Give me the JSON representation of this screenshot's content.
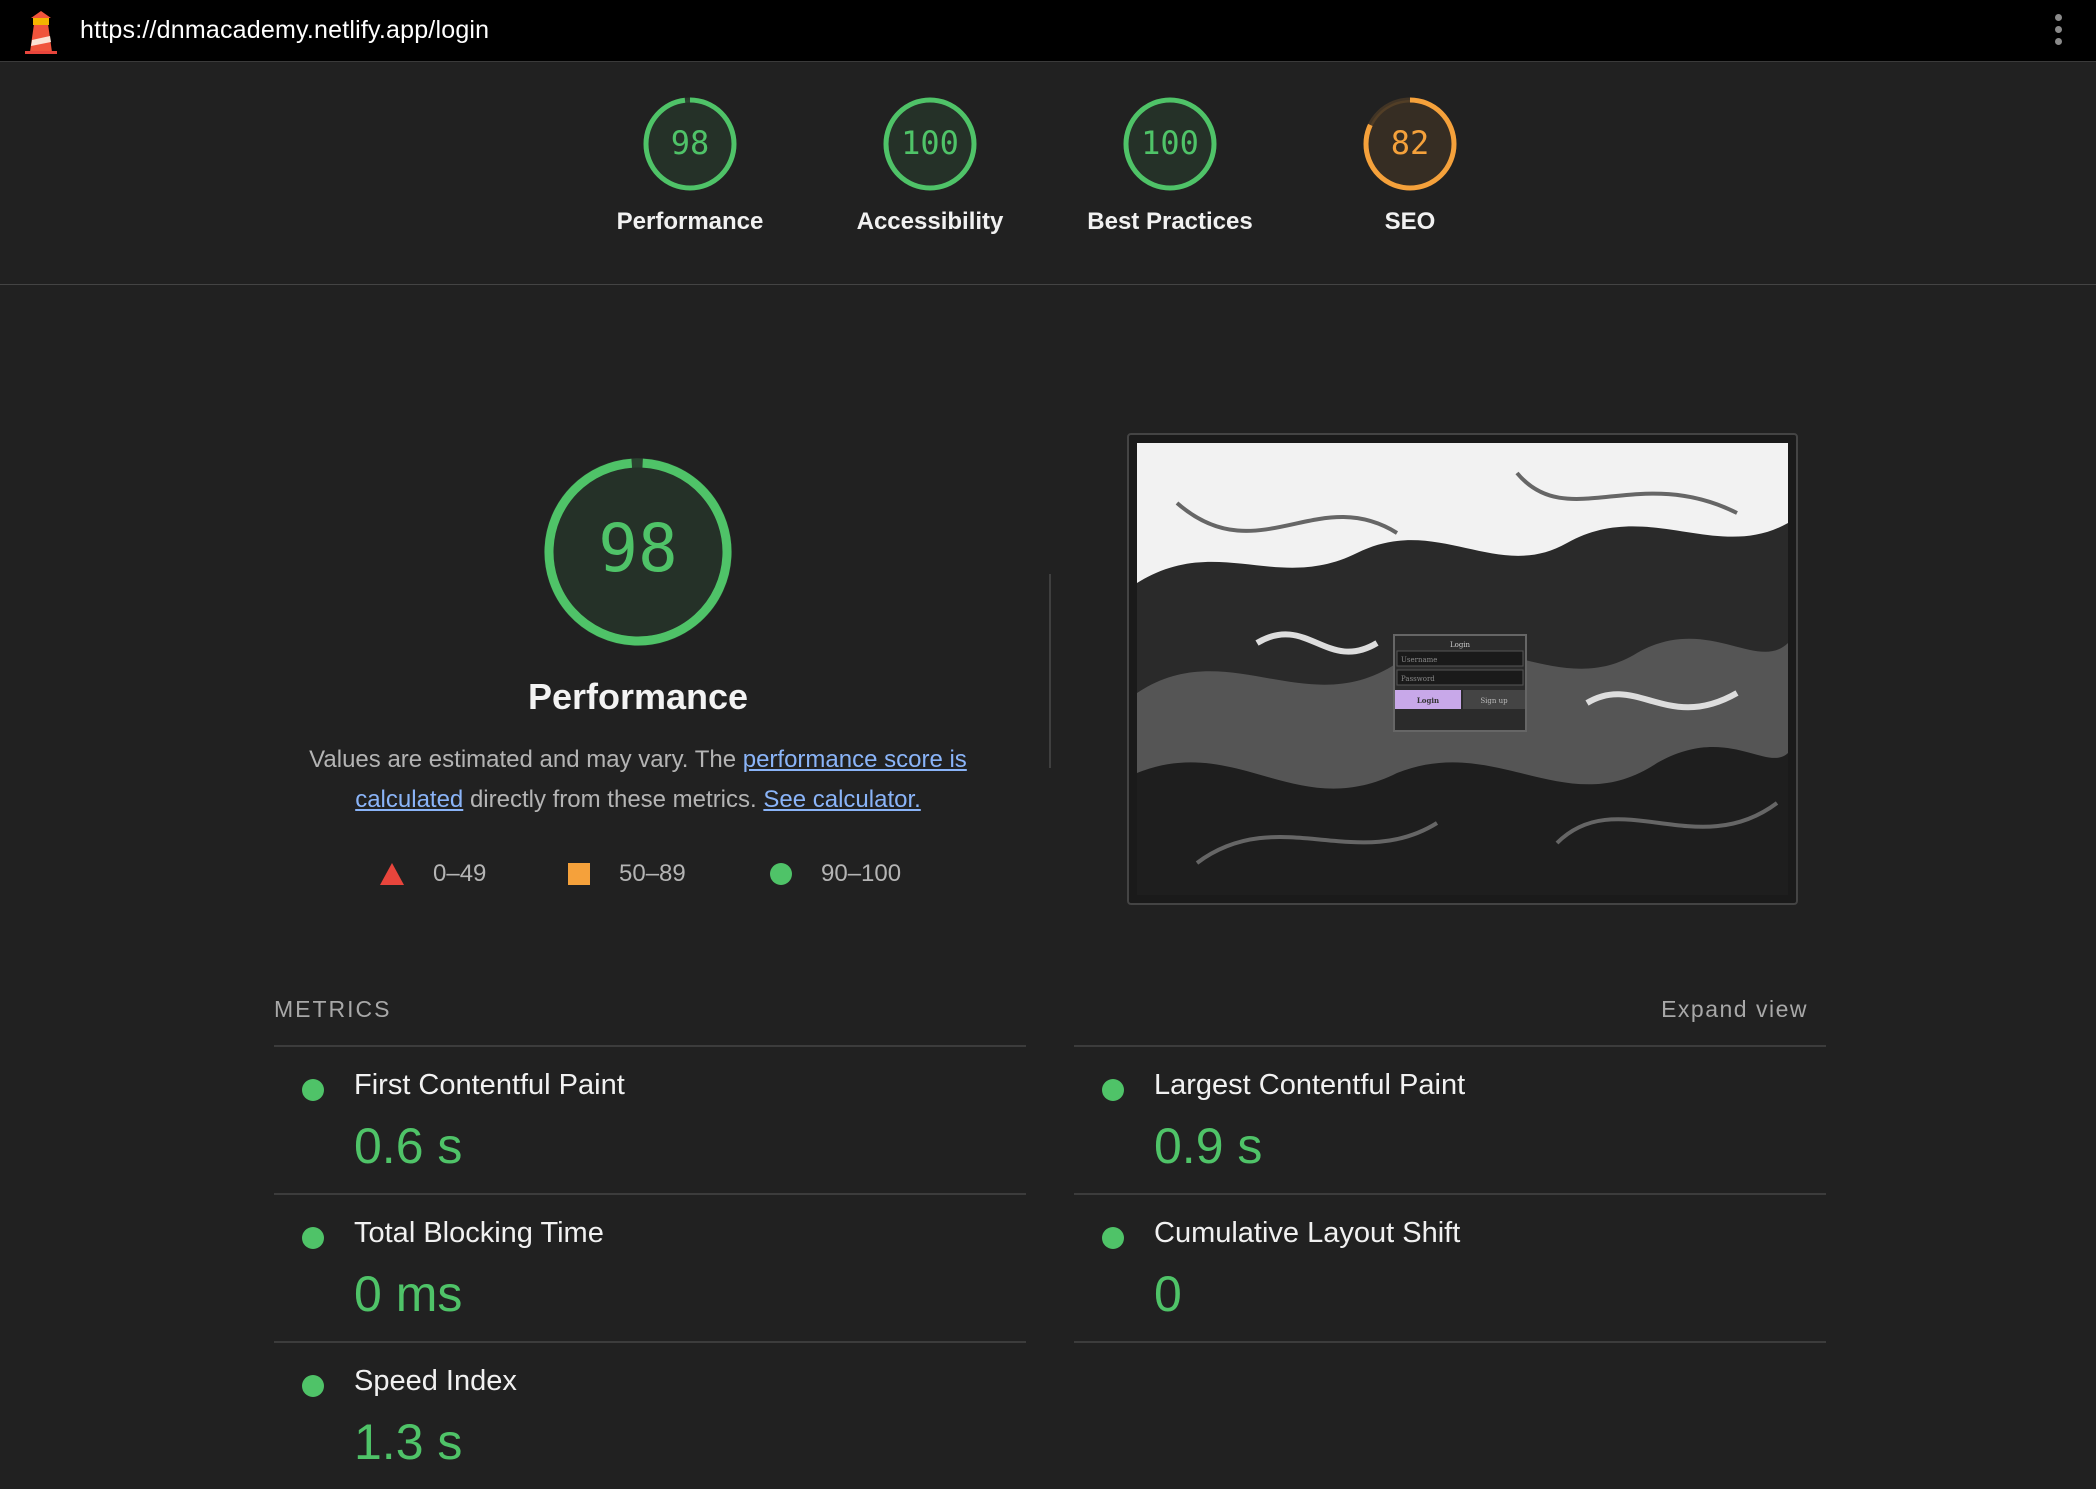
{
  "browser": {
    "url": "https://dnmacademy.netlify.app/login",
    "logo_icon": "lighthouse-icon",
    "menu_icon": "kebab-menu-icon"
  },
  "categories": [
    {
      "label": "Performance",
      "score": "98",
      "color": "#4fc368",
      "fraction": 0.98
    },
    {
      "label": "Accessibility",
      "score": "100",
      "color": "#4fc368",
      "fraction": 1.0
    },
    {
      "label": "Best Practices",
      "score": "100",
      "color": "#4fc368",
      "fraction": 1.0
    },
    {
      "label": "SEO",
      "score": "82",
      "color": "#f5a13b",
      "fraction": 0.82
    }
  ],
  "performance": {
    "score": "98",
    "fraction": 0.98,
    "title": "Performance",
    "desc_part1": "Values are estimated and may vary. The ",
    "link1": "performance score is calculated",
    "desc_part2": " directly from these metrics. ",
    "link2": "See calculator."
  },
  "legend": [
    {
      "range": "0–49",
      "shape": "triangle",
      "color": "#e8453c"
    },
    {
      "range": "50–89",
      "shape": "square",
      "color": "#f5a13b"
    },
    {
      "range": "90–100",
      "shape": "circle",
      "color": "#4fc368"
    }
  ],
  "screenshot": {
    "form_title": "Login",
    "username_placeholder": "Username",
    "password_placeholder": "Password",
    "login_button": "Login",
    "signup_button": "Sign up"
  },
  "metrics": {
    "heading": "METRICS",
    "expand_label": "Expand view",
    "left": [
      {
        "name": "First Contentful Paint",
        "value": "0.6 s"
      },
      {
        "name": "Total Blocking Time",
        "value": "0 ms"
      },
      {
        "name": "Speed Index",
        "value": "1.3 s"
      }
    ],
    "right": [
      {
        "name": "Largest Contentful Paint",
        "value": "0.9 s"
      },
      {
        "name": "Cumulative Layout Shift",
        "value": "0"
      }
    ]
  }
}
